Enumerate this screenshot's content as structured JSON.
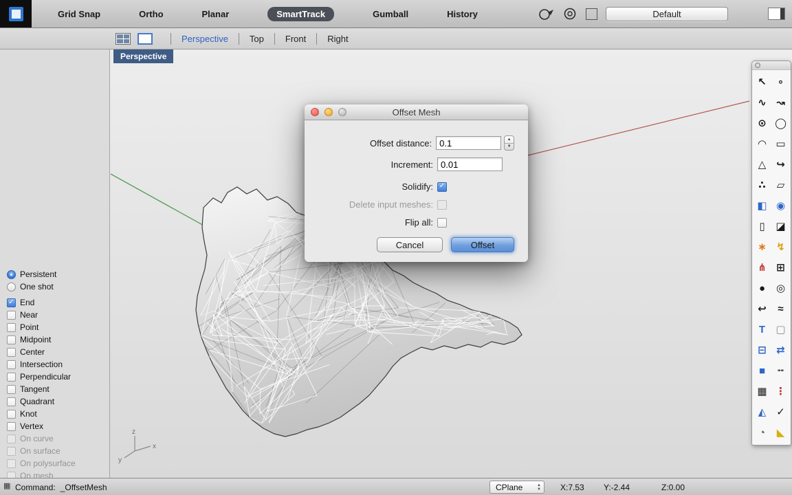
{
  "top_toolbar": {
    "buttons": [
      {
        "label": "Grid Snap"
      },
      {
        "label": "Ortho"
      },
      {
        "label": "Planar"
      },
      {
        "label": "SmartTrack",
        "active": true
      },
      {
        "label": "Gumball"
      },
      {
        "label": "History"
      }
    ],
    "layer_swatch_color": "#000000",
    "display_mode": "Default"
  },
  "view_toolbar": {
    "tabs": [
      {
        "label": "Perspective",
        "active": true
      },
      {
        "label": "Top"
      },
      {
        "label": "Front"
      },
      {
        "label": "Right"
      }
    ]
  },
  "viewport": {
    "label": "Perspective",
    "axis_labels": {
      "x": "x",
      "y": "y",
      "z": "z"
    }
  },
  "osnap": {
    "modes": [
      {
        "label": "Persistent",
        "selected": true
      },
      {
        "label": "One shot"
      }
    ],
    "snaps": [
      {
        "label": "End",
        "checked": true
      },
      {
        "label": "Near"
      },
      {
        "label": "Point"
      },
      {
        "label": "Midpoint"
      },
      {
        "label": "Center"
      },
      {
        "label": "Intersection"
      },
      {
        "label": "Perpendicular"
      },
      {
        "label": "Tangent"
      },
      {
        "label": "Quadrant"
      },
      {
        "label": "Knot"
      },
      {
        "label": "Vertex"
      },
      {
        "label": "On curve",
        "enabled": false
      },
      {
        "label": "On surface",
        "enabled": false
      },
      {
        "label": "On polysurface",
        "enabled": false
      },
      {
        "label": "On mesh",
        "enabled": false
      }
    ]
  },
  "dialog": {
    "title": "Offset Mesh",
    "offset_distance_label": "Offset distance:",
    "offset_distance_value": "0.1",
    "increment_label": "Increment:",
    "increment_value": "0.01",
    "checkboxes": [
      {
        "label": "Solidify:",
        "checked": true
      },
      {
        "label": "Delete input meshes:",
        "enabled": false
      },
      {
        "label": "Flip all:"
      }
    ],
    "cancel_label": "Cancel",
    "offset_label": "Offset"
  },
  "tools": [
    {
      "name": "pointer-tool-icon",
      "glyph": "↖",
      "color": "#1a1a1a"
    },
    {
      "name": "point-tool-icon",
      "glyph": "∘",
      "color": "#1a1a1a"
    },
    {
      "name": "curve-tool-icon",
      "glyph": "∿",
      "color": "#1a1a1a"
    },
    {
      "name": "interpcurve-tool-icon",
      "glyph": "↝",
      "color": "#1a1a1a"
    },
    {
      "name": "circle-tool-icon",
      "glyph": "⊙",
      "color": "#1a1a1a"
    },
    {
      "name": "ellipse-tool-icon",
      "glyph": "◯",
      "color": "#1a1a1a"
    },
    {
      "name": "arc-tool-icon",
      "glyph": "◠",
      "color": "#1a1a1a"
    },
    {
      "name": "rectangle-tool-icon",
      "glyph": "▭",
      "color": "#1a1a1a"
    },
    {
      "name": "polygon-tool-icon",
      "glyph": "△",
      "color": "#1a1a1a"
    },
    {
      "name": "freeform-tool-icon",
      "glyph": "↪",
      "color": "#1a1a1a"
    },
    {
      "name": "pointcloud-tool-icon",
      "glyph": "∴",
      "color": "#1a1a1a"
    },
    {
      "name": "plane-tool-icon",
      "glyph": "▱",
      "color": "#1a1a1a"
    },
    {
      "name": "box-tool-icon",
      "glyph": "◧",
      "color": "#2f66c8"
    },
    {
      "name": "sphere-tool-icon",
      "glyph": "◉",
      "color": "#2f66c8"
    },
    {
      "name": "cylinder-tool-icon",
      "glyph": "▯",
      "color": "#1a1a1a"
    },
    {
      "name": "extrude-tool-icon",
      "glyph": "◪",
      "color": "#1a1a1a"
    },
    {
      "name": "mesh-tool-icon",
      "glyph": "∗",
      "color": "#e07818"
    },
    {
      "name": "render-tool-icon",
      "glyph": "↯",
      "color": "#d8a010"
    },
    {
      "name": "analyze-tool-icon",
      "glyph": "⋔",
      "color": "#c03030"
    },
    {
      "name": "array-tool-icon",
      "glyph": "⊞",
      "color": "#1a1a1a"
    },
    {
      "name": "sphere-dark-tool-icon",
      "glyph": "●",
      "color": "#1a1a1a"
    },
    {
      "name": "torus-tool-icon",
      "glyph": "◎",
      "color": "#1a1a1a"
    },
    {
      "name": "hook-tool-icon",
      "glyph": "↩",
      "color": "#1a1a1a"
    },
    {
      "name": "spring-tool-icon",
      "glyph": "≈",
      "color": "#1a1a1a"
    },
    {
      "name": "text-tool-icon",
      "glyph": "T",
      "color": "#2f66c8"
    },
    {
      "name": "boundingbox-tool-icon",
      "glyph": "▢",
      "color": "#8a8a8a"
    },
    {
      "name": "split-tool-icon",
      "glyph": "⊟",
      "color": "#2f66c8"
    },
    {
      "name": "mirror-tool-icon",
      "glyph": "⇄",
      "color": "#2f66c8"
    },
    {
      "name": "solid-tool-icon",
      "glyph": "■",
      "color": "#2f66c8"
    },
    {
      "name": "dashed-tool-icon",
      "glyph": "╍",
      "color": "#555555"
    },
    {
      "name": "grid-tool-icon",
      "glyph": "▦",
      "color": "#1a1a1a"
    },
    {
      "name": "pointcolumn-tool-icon",
      "glyph": "⋮",
      "color": "#c03030"
    },
    {
      "name": "prism-tool-icon",
      "glyph": "◭",
      "color": "#2f66c8"
    },
    {
      "name": "check-tool-icon",
      "glyph": "✓",
      "color": "#1a1a1a"
    },
    {
      "name": "pie-tool-icon",
      "glyph": "◔",
      "color": "#555555"
    },
    {
      "name": "wedge-tool-icon",
      "glyph": "◣",
      "color": "#d8b010"
    }
  ],
  "status_bar": {
    "command_label": "Command:",
    "command_value": "_OffsetMesh",
    "cplane_label": "CPlane",
    "x": "X:7.53",
    "y": "Y:-2.44",
    "z": "Z:0.00"
  }
}
